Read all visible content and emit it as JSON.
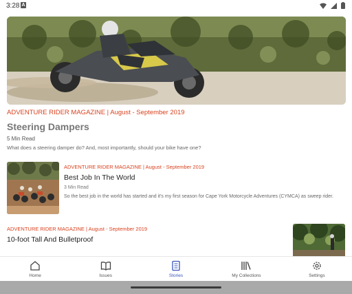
{
  "status_bar": {
    "time": "3:28",
    "badge": "A",
    "icons": [
      "wifi-icon",
      "signal-icon",
      "battery-icon"
    ]
  },
  "featured_story": {
    "publication": "ADVENTURE RIDER MAGAZINE | August - September 2019",
    "title": "Steering Dampers",
    "read_time": "5 Min Read",
    "description": "What does a steering damper do? And, most importantly, should your bike have one?"
  },
  "stories": [
    {
      "publication": "ADVENTURE RIDER MAGAZINE | August - September 2019",
      "title": "Best Job In The World",
      "read_time": "3 Min Read",
      "description": "So the best job in the world has started and it's my first season for Cape York Motorcycle Adventures (CYMCA) as sweep rider."
    },
    {
      "publication": "ADVENTURE RIDER MAGAZINE | August - September 2019",
      "title": "10-foot Tall And Bulletproof"
    }
  ],
  "bottom_nav": {
    "items": [
      {
        "label": "Home",
        "icon": "home-icon"
      },
      {
        "label": "Issues",
        "icon": "book-icon"
      },
      {
        "label": "Stories",
        "icon": "document-icon",
        "active": true
      },
      {
        "label": "My Collections",
        "icon": "collections-icon"
      },
      {
        "label": "Settings",
        "icon": "gear-icon"
      }
    ]
  },
  "colors": {
    "accent": "#d9411e",
    "nav_active": "#3a56b8",
    "background": "#ffffff"
  }
}
